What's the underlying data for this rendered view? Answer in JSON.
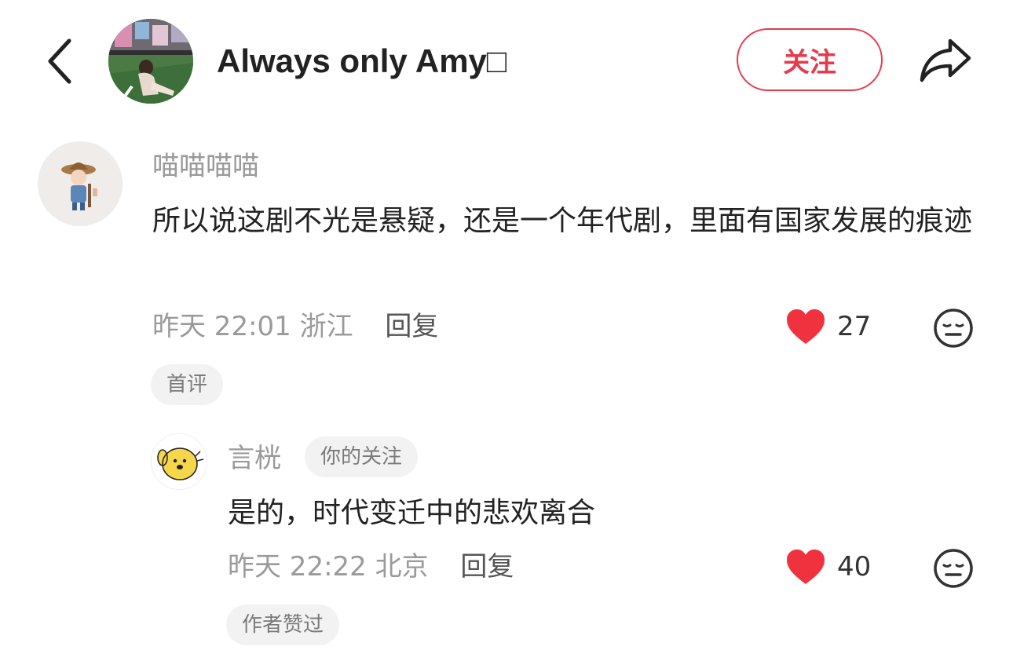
{
  "header": {
    "title": "Always only Amy□",
    "follow_label": "关注",
    "back_icon": "chevron-left-icon",
    "share_icon": "share-arrow-icon"
  },
  "comments": [
    {
      "username": "喵喵喵喵",
      "text": "所以说这剧不光是悬疑，还是一个年代剧，里面有国家发展的痕迹",
      "time": "昨天 22:01",
      "location": "浙江",
      "reply_label": "回复",
      "likes": "27",
      "tag": "首评"
    },
    {
      "username": "言桄",
      "badge": "你的关注",
      "text": "是的，时代变迁中的悲欢离合",
      "time": "昨天 22:22",
      "location": "北京",
      "reply_label": "回复",
      "likes": "40",
      "tag": "作者赞过"
    }
  ],
  "colors": {
    "accent": "#e63b4d",
    "heart": "#f0323f",
    "muted_text": "#9a9a9a",
    "tag_bg": "#f2f2f2"
  }
}
